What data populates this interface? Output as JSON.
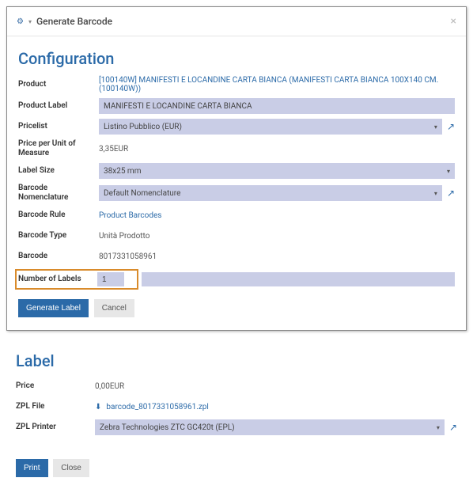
{
  "modal": {
    "title": "Generate Barcode",
    "close": "×"
  },
  "config": {
    "heading": "Configuration",
    "rows": {
      "product_label_txt": "Product",
      "product_value": "[100140W] MANIFESTI E LOCANDINE CARTA BIANCA (MANIFESTI CARTA BIANCA 100X140 CM. (100140W))",
      "productlabel_label": "Product Label",
      "productlabel_value": "MANIFESTI E LOCANDINE CARTA BIANCA",
      "pricelist_label": "Pricelist",
      "pricelist_value": "Listino Pubblico (EUR)",
      "ppu_label": "Price per Unit of Measure",
      "ppu_value": "3,35EUR",
      "labelsize_label": "Label Size",
      "labelsize_value": "38x25 mm",
      "nomen_label": "Barcode Nomenclature",
      "nomen_value": "Default Nomenclature",
      "rule_label": "Barcode Rule",
      "rule_value": "Product Barcodes",
      "type_label": "Barcode Type",
      "type_value": "Unità Prodotto",
      "barcode_label": "Barcode",
      "barcode_value": "8017331058961",
      "numlabels_label": "Number of Labels",
      "numlabels_value": "1"
    },
    "buttons": {
      "generate": "Generate Label",
      "cancel": "Cancel"
    }
  },
  "label_section": {
    "heading": "Label",
    "price_label": "Price",
    "price_value": "0,00EUR",
    "zplfile_label": "ZPL File",
    "zplfile_value": "barcode_8017331058961.zpl",
    "zplprinter_label": "ZPL Printer",
    "zplprinter_value": "Zebra Technologies ZTC GC420t (EPL)",
    "buttons": {
      "print": "Print",
      "close": "Close"
    }
  },
  "icons": {
    "caret_down": "▾",
    "select_arrow": "▾",
    "external": "↗",
    "download": "⬇"
  }
}
